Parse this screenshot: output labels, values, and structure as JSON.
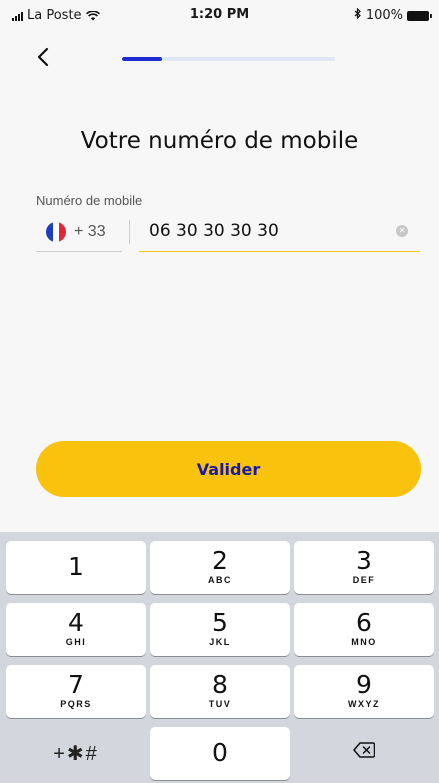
{
  "status_bar": {
    "carrier": "La Poste",
    "time": "1:20 PM",
    "battery": "100%",
    "icons": [
      "signal-bars-icon",
      "wifi-icon",
      "bluetooth-icon",
      "battery-icon"
    ]
  },
  "nav": {
    "back_icon": "chevron-left-icon",
    "progress": 0.19
  },
  "page": {
    "title": "Votre numéro de mobile"
  },
  "phone_field": {
    "label": "Numéro de mobile",
    "country_flag": "france-flag-icon",
    "dial_code": "+ 33",
    "value": "06 30 30 30 30",
    "clear_icon": "clear-circle-icon"
  },
  "actions": {
    "validate_label": "Valider"
  },
  "keypad": {
    "keys": [
      {
        "digit": "1",
        "letters": ""
      },
      {
        "digit": "2",
        "letters": "ABC"
      },
      {
        "digit": "3",
        "letters": "DEF"
      },
      {
        "digit": "4",
        "letters": "GHI"
      },
      {
        "digit": "5",
        "letters": "JKL"
      },
      {
        "digit": "6",
        "letters": "MNO"
      },
      {
        "digit": "7",
        "letters": "PQRS"
      },
      {
        "digit": "8",
        "letters": "TUV"
      },
      {
        "digit": "9",
        "letters": "WXYZ"
      }
    ],
    "symbols_label": "+✱#",
    "zero": "0",
    "backspace_icon": "backspace-icon"
  },
  "colors": {
    "accent_yellow": "#F8C20D",
    "button_text_blue": "#1A1AA8",
    "progress_blue": "#1E2CCF",
    "progress_track": "#DFE7F4",
    "keypad_bg": "#D3D6DC"
  }
}
